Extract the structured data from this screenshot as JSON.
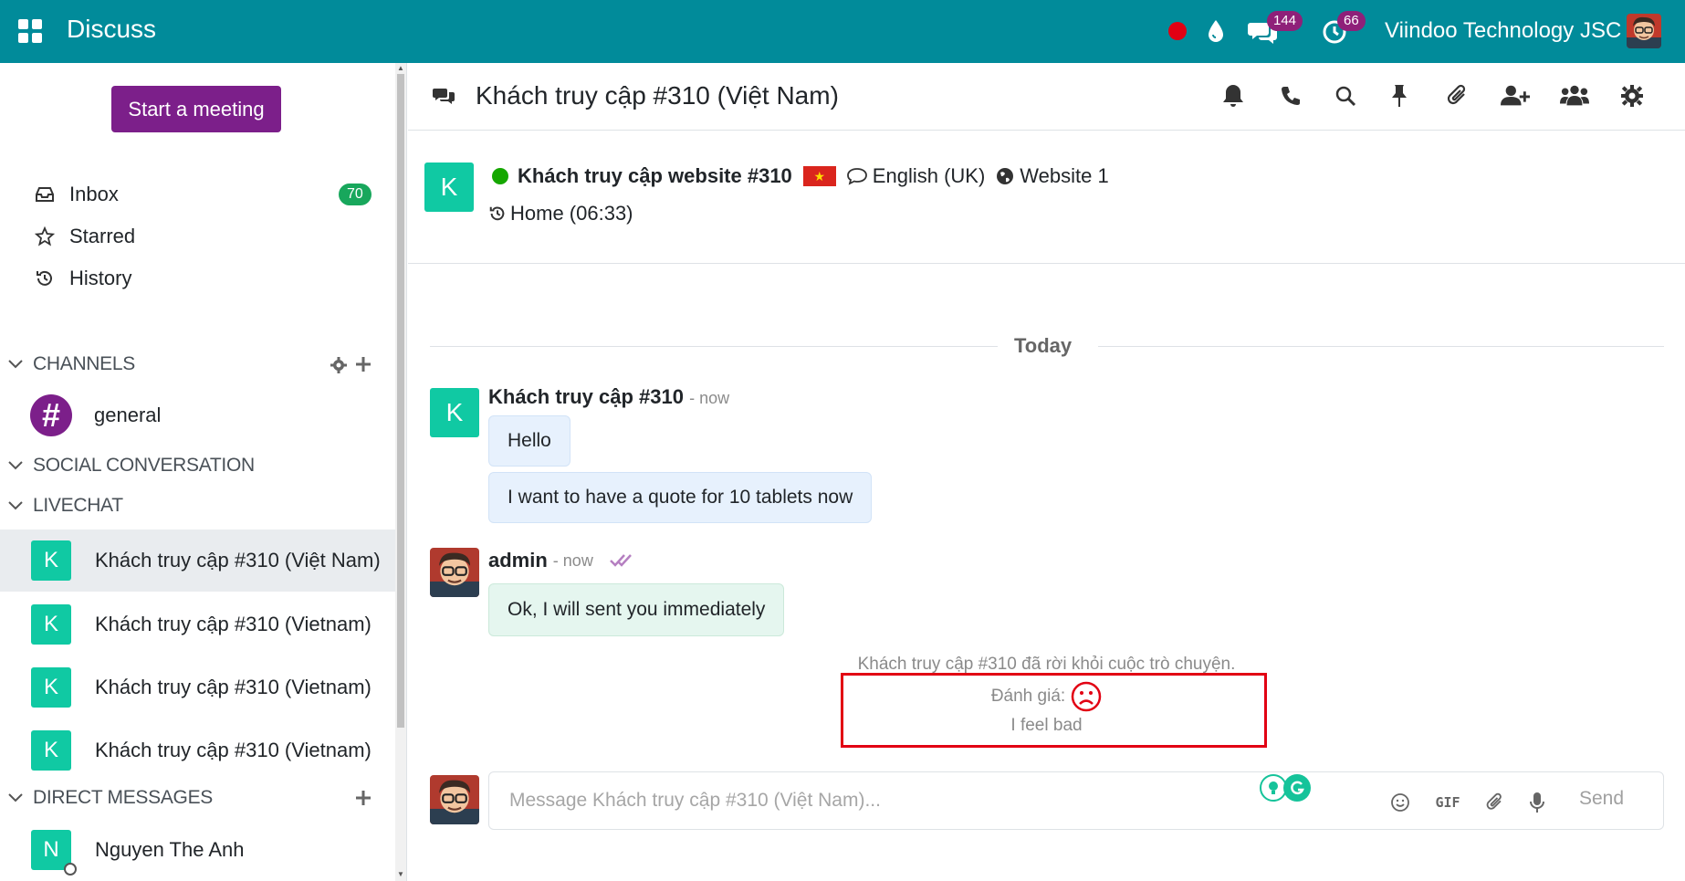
{
  "app": {
    "title": "Discuss"
  },
  "navbar": {
    "messages_badge": "144",
    "activity_badge": "66",
    "company": "Viindoo Technology JSC"
  },
  "sidebar": {
    "start_meeting": "Start a meeting",
    "mailboxes": [
      {
        "label": "Inbox",
        "badge": "70",
        "icon": "inbox-icon"
      },
      {
        "label": "Starred",
        "icon": "star-icon"
      },
      {
        "label": "History",
        "icon": "history-icon"
      }
    ],
    "sections": {
      "channels": "CHANNELS",
      "social": "SOCIAL CONVERSATION",
      "livechat": "LIVECHAT",
      "direct": "DIRECT MESSAGES"
    },
    "channels": [
      {
        "name": "general",
        "avatar": "#"
      }
    ],
    "livechats": [
      {
        "name": "Khách truy cập #310 (Việt Nam)",
        "avatar": "K",
        "active": true
      },
      {
        "name": "Khách truy cập #310 (Vietnam)",
        "avatar": "K"
      },
      {
        "name": "Khách truy cập #310 (Vietnam)",
        "avatar": "K"
      },
      {
        "name": "Khách truy cập #310 (Vietnam)",
        "avatar": "K"
      }
    ],
    "direct_messages": [
      {
        "name": "Nguyen The Anh",
        "avatar": "N"
      }
    ]
  },
  "thread": {
    "title": "Khách truy cập #310 (Việt Nam)",
    "actions": [
      "bell-icon",
      "phone-icon",
      "search-icon",
      "pin-icon",
      "paperclip-icon",
      "add-user-icon",
      "members-icon",
      "gear-icon"
    ]
  },
  "visitor": {
    "avatar": "K",
    "name": "Khách truy cập website #310",
    "flag_star": "★",
    "language": "English (UK)",
    "website": "Website 1",
    "history": "Home (06:33)"
  },
  "messages": {
    "date_separator": "Today",
    "visitor_author": "Khách truy cập #310",
    "visitor_avatar": "K",
    "visitor_time": "- now",
    "visitor_msg_1": "Hello",
    "visitor_msg_2": "I want to have a quote for 10 tablets now",
    "admin_author": "admin",
    "admin_time": "- now",
    "admin_msg": "Ok, I will sent you immediately",
    "left_notice": "Khách truy cập #310 đã rời khỏi cuộc trò chuyện.",
    "rating_label": "Đánh giá:",
    "rating_comment": "I feel bad"
  },
  "composer": {
    "placeholder": "Message Khách truy cập #310 (Việt Nam)...",
    "gif_label": "GIF",
    "send_label": "Send"
  },
  "colors": {
    "navbar": "#018b9a",
    "primary": "#7c1f8a",
    "avatar_teal": "#10c9a3",
    "badge_green": "#18a75c",
    "badge_purple": "#8f2079",
    "rating_red": "#e20013"
  }
}
